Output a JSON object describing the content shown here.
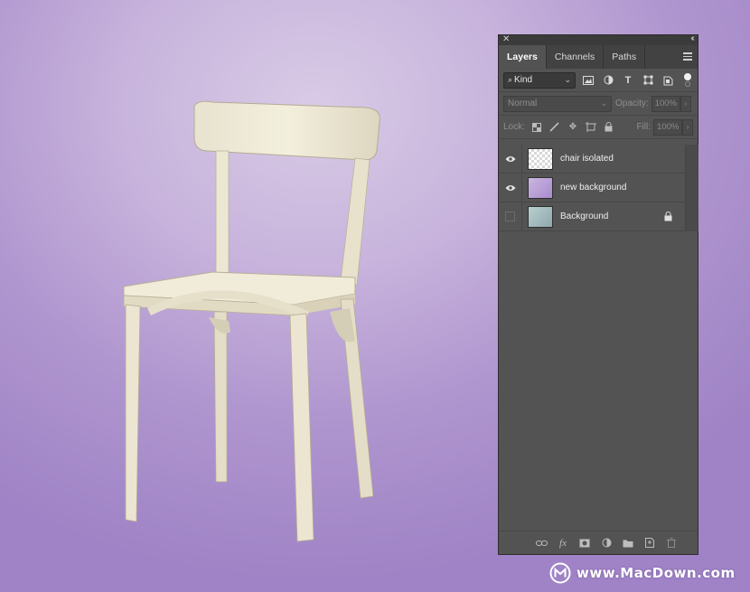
{
  "panel": {
    "tabs": [
      {
        "label": "Layers",
        "active": true
      },
      {
        "label": "Channels",
        "active": false
      },
      {
        "label": "Paths",
        "active": false
      }
    ],
    "filter": {
      "kind_label": "Kind"
    },
    "blend_mode": "Normal",
    "opacity_label": "Opacity:",
    "opacity_value": "100%",
    "lock_label": "Lock:",
    "fill_label": "Fill:",
    "fill_value": "100%",
    "layers": [
      {
        "name": "chair isolated",
        "visible": true,
        "locked": false
      },
      {
        "name": "new background",
        "visible": true,
        "locked": false
      },
      {
        "name": "Background",
        "visible": false,
        "locked": true
      }
    ]
  },
  "watermark": {
    "text": "www.MacDown.com"
  },
  "colors": {
    "panel_bg": "#535353",
    "canvas_bg": "#b49ad2"
  }
}
